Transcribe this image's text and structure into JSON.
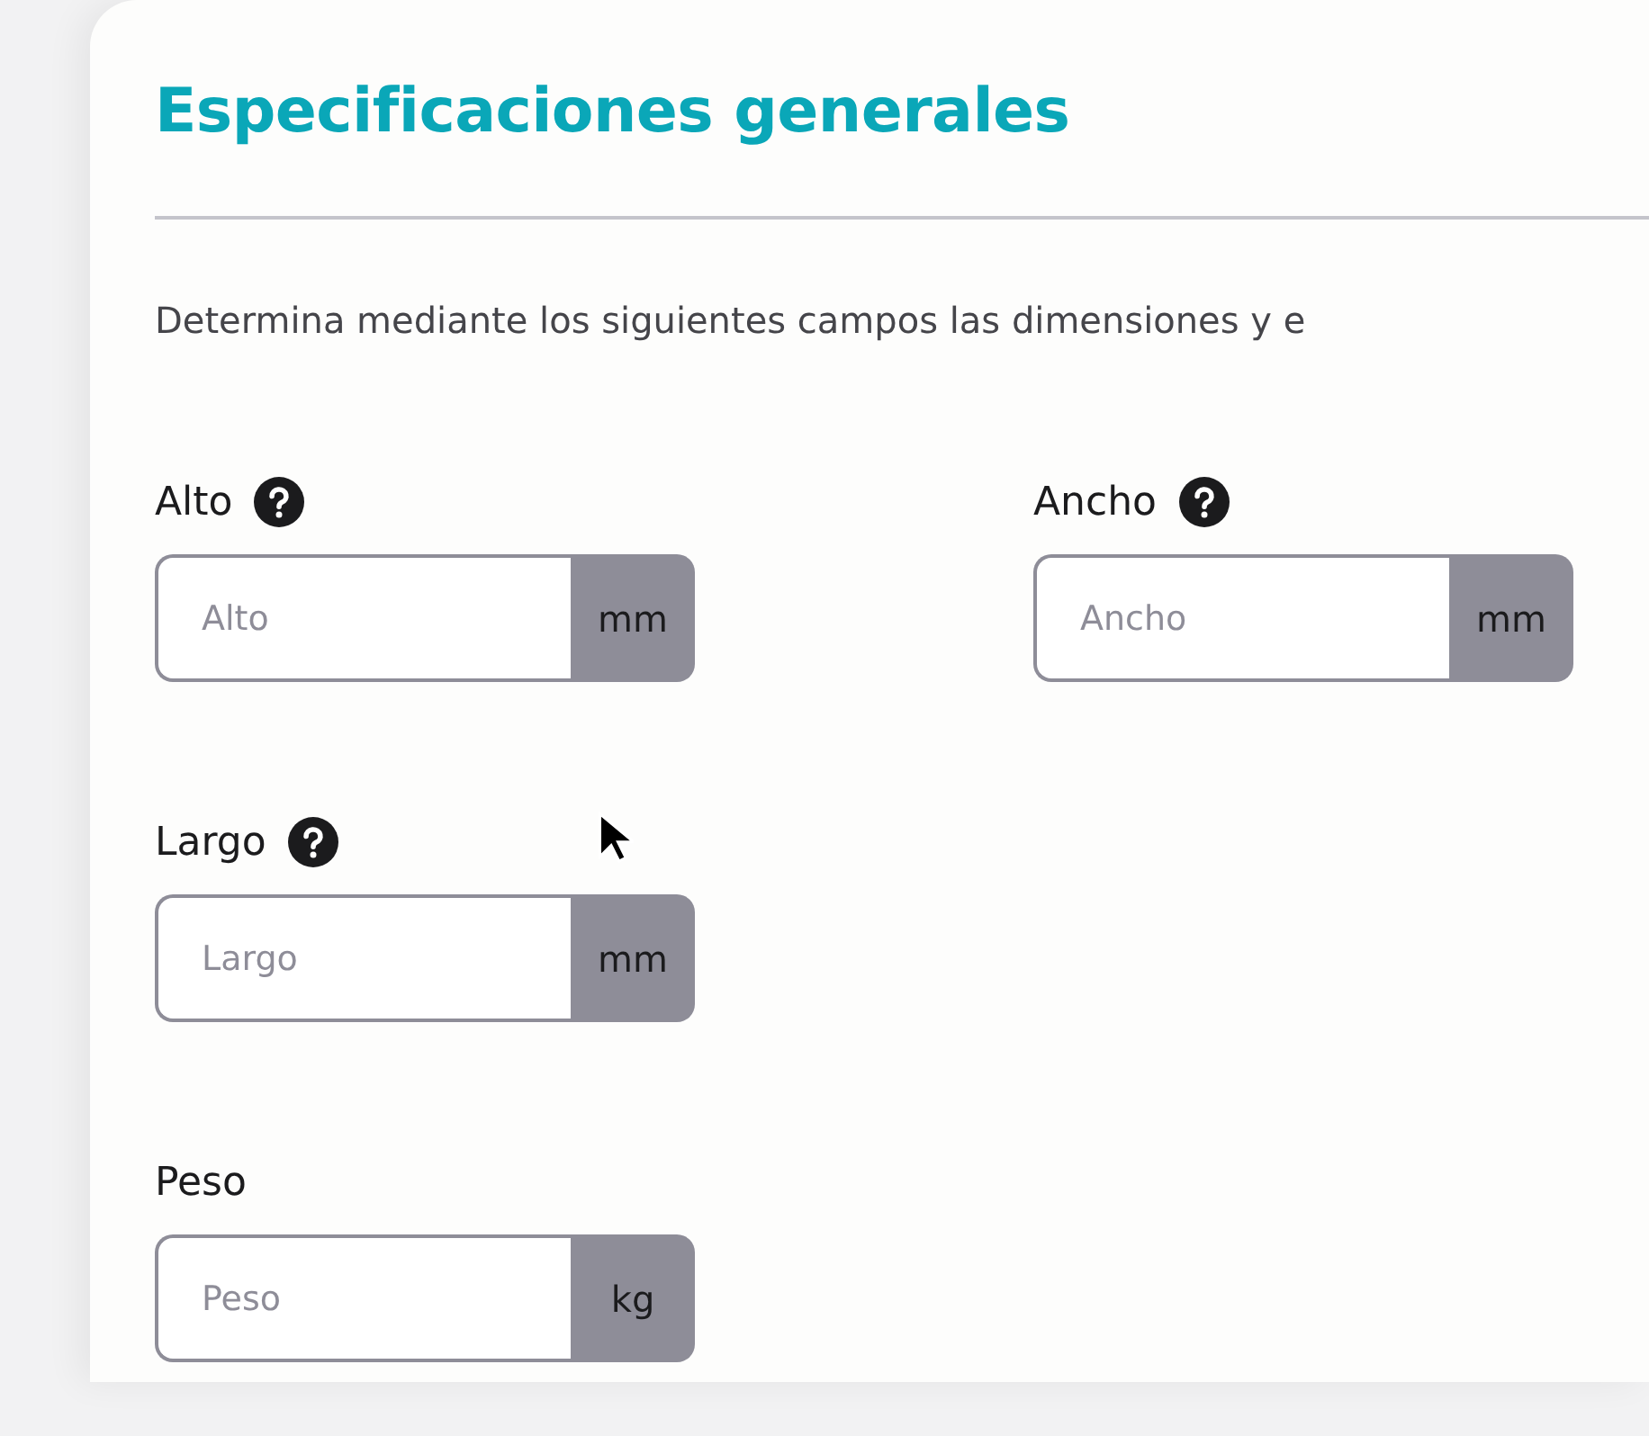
{
  "section": {
    "title": "Especificaciones generales",
    "description": "Determina mediante los siguientes campos las dimensiones y e"
  },
  "field_rows": [
    {
      "fields": [
        {
          "label": "Alto",
          "help": true,
          "placeholder": "Alto",
          "unit": "mm"
        },
        {
          "label": "Ancho",
          "help": true,
          "placeholder": "Ancho",
          "unit": "mm"
        }
      ]
    },
    {
      "fields": [
        {
          "label": "Largo",
          "help": true,
          "placeholder": "Largo",
          "unit": "mm"
        }
      ]
    },
    {
      "fields": [
        {
          "label": "Peso",
          "help": false,
          "placeholder": "Peso",
          "unit": "kg"
        }
      ]
    }
  ]
}
